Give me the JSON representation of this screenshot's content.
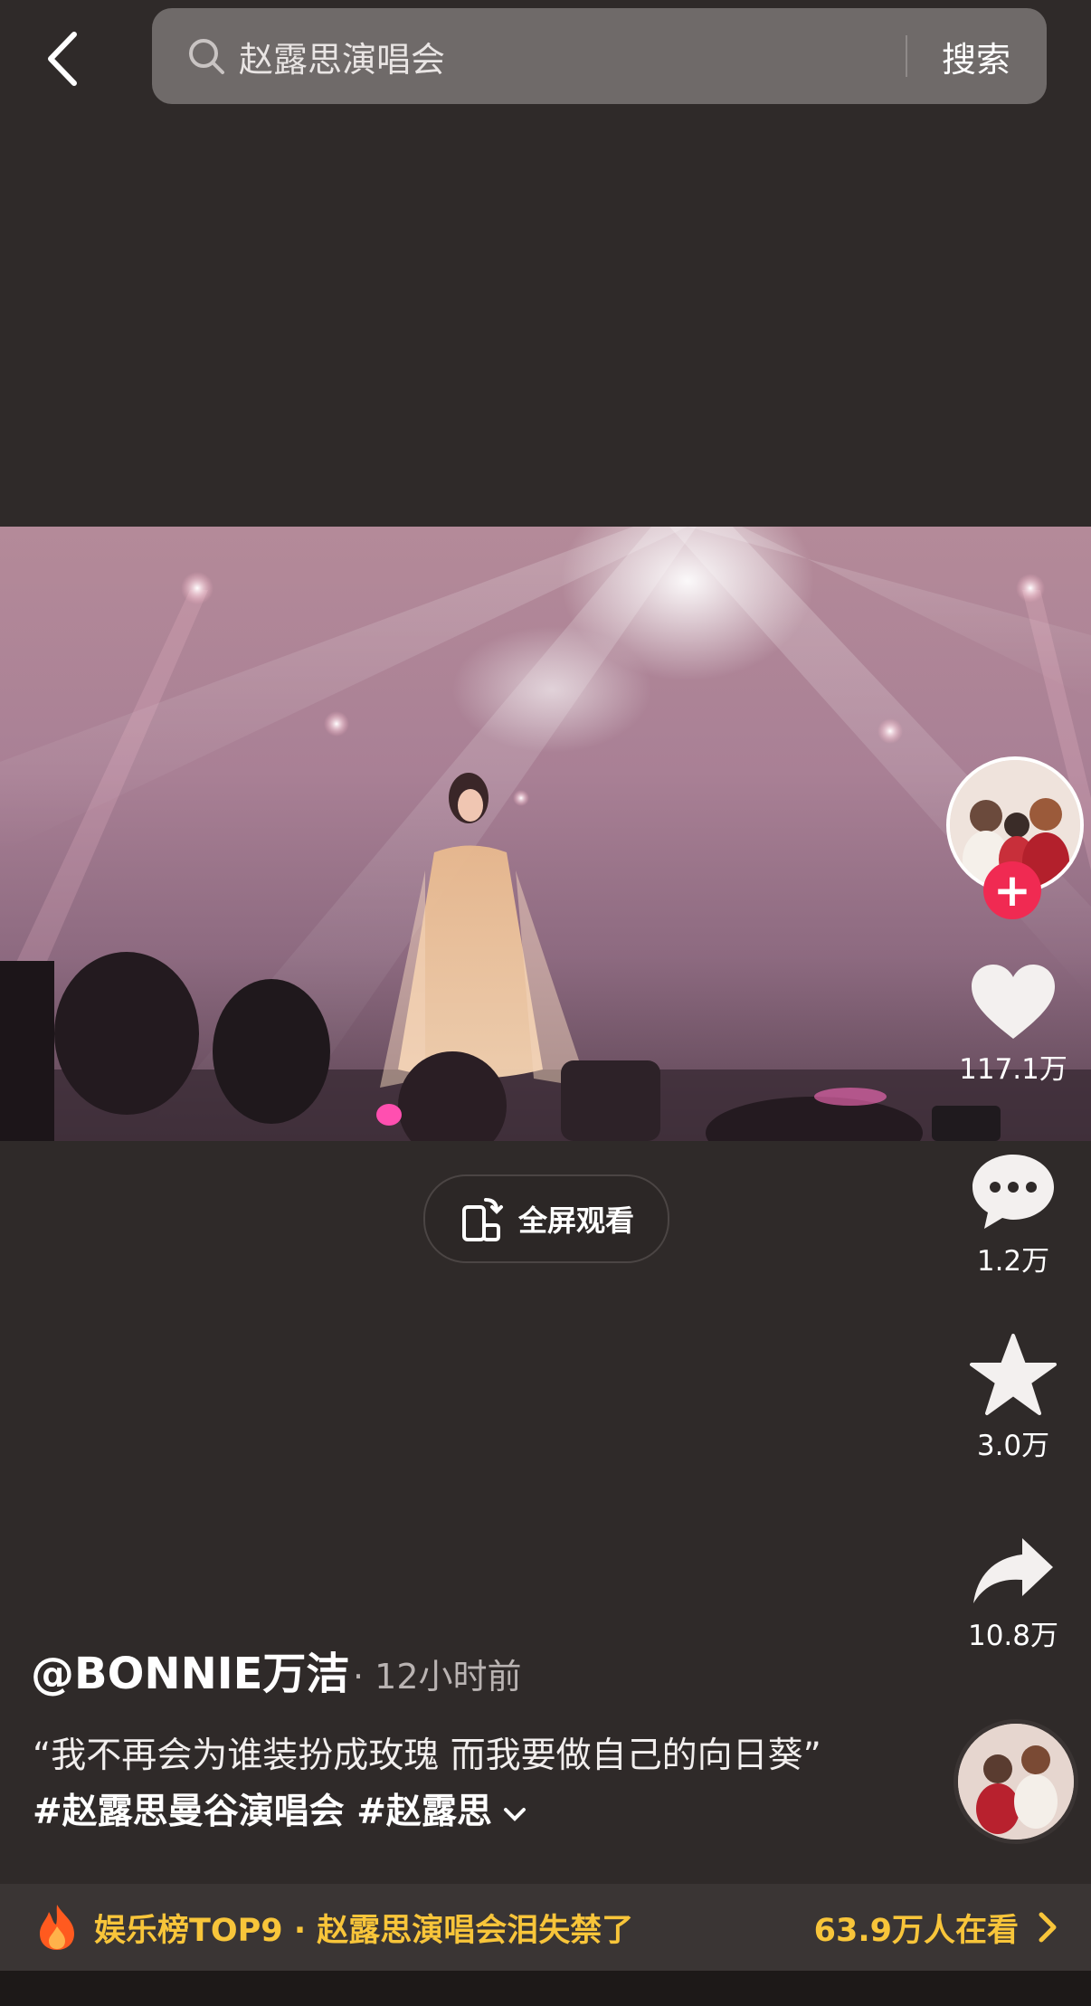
{
  "search": {
    "query": "赵露思演唱会",
    "button_label": "搜索"
  },
  "video": {
    "fullscreen_label": "全屏观看"
  },
  "actions": {
    "like_count": "117.1万",
    "comment_count": "1.2万",
    "favorite_count": "3.0万",
    "share_count": "10.8万"
  },
  "post": {
    "author": "@BONNIE万洁",
    "time_ago": "· 12小时前",
    "caption_text": "“我不再会为谁装扮成玫瑰 而我要做自己的向日葵”",
    "caption_tags": "#赵露思曼谷演唱会 #赵露思"
  },
  "hot": {
    "title": "娱乐榜TOP9 · 赵露思演唱会泪失禁了",
    "viewers": "63.9万人在看"
  },
  "colors": {
    "background": "#2f2a29",
    "accent_yellow": "#f8c53a",
    "follow_red": "#f02a52"
  },
  "icons": [
    "back-arrow-icon",
    "search-icon",
    "rotate-screen-icon",
    "plus-icon",
    "heart-icon",
    "comment-icon",
    "star-icon",
    "share-icon",
    "fire-icon",
    "chevron-right-icon",
    "chevron-down-icon"
  ]
}
